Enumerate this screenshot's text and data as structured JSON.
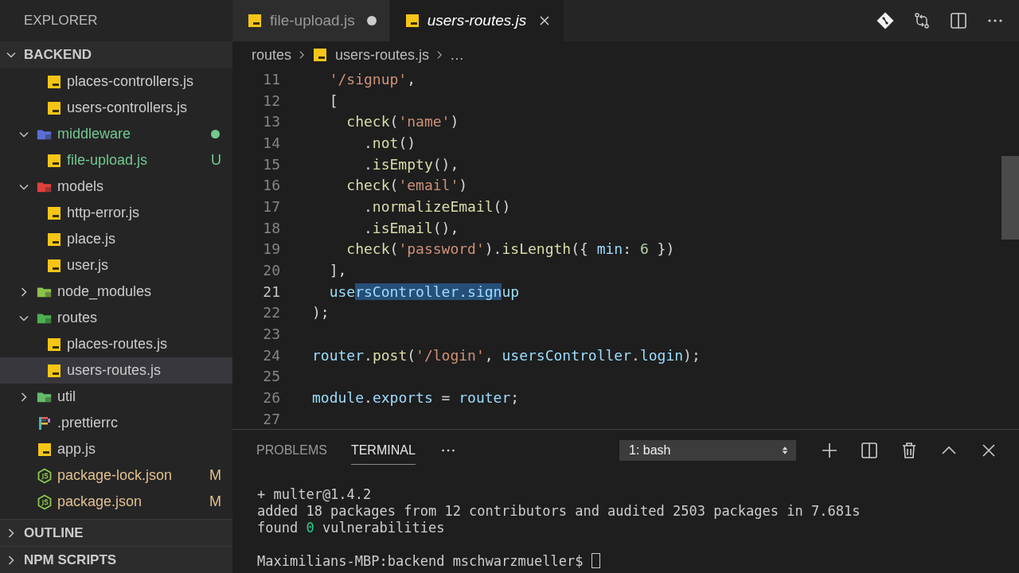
{
  "sidebar": {
    "title": "EXPLORER",
    "section": {
      "label": "BACKEND",
      "expanded": true,
      "tree": [
        {
          "kind": "group",
          "children": [
            {
              "kind": "js",
              "label": "places-controllers.js",
              "selected": false,
              "untracked": false,
              "modified": false
            },
            {
              "kind": "js",
              "label": "users-controllers.js",
              "selected": false,
              "untracked": false,
              "modified": false
            }
          ]
        },
        {
          "kind": "folder",
          "label": "middleware",
          "color": "#5a6fd6",
          "expanded": true,
          "selected": false,
          "untracked": true,
          "modified": false,
          "children": [
            {
              "kind": "js",
              "label": "file-upload.js",
              "selected": false,
              "untracked": true,
              "modified": false,
              "badge": "U"
            }
          ]
        },
        {
          "kind": "folder",
          "label": "models",
          "color": "#e0413c",
          "expanded": true,
          "selected": false,
          "untracked": false,
          "modified": false,
          "children": [
            {
              "kind": "js",
              "label": "http-error.js",
              "selected": false,
              "untracked": false,
              "modified": false
            },
            {
              "kind": "js",
              "label": "place.js",
              "selected": false,
              "untracked": false,
              "modified": false
            },
            {
              "kind": "js",
              "label": "user.js",
              "selected": false,
              "untracked": false,
              "modified": false
            }
          ]
        },
        {
          "kind": "folder",
          "label": "node_modules",
          "color": "#8bc34a",
          "expanded": false,
          "selected": false,
          "untracked": false,
          "modified": false
        },
        {
          "kind": "folder",
          "label": "routes",
          "color": "#4caf50",
          "expanded": true,
          "selected": false,
          "untracked": false,
          "modified": false,
          "children": [
            {
              "kind": "js",
              "label": "places-routes.js",
              "selected": false,
              "untracked": false,
              "modified": false
            },
            {
              "kind": "js",
              "label": "users-routes.js",
              "selected": true,
              "untracked": false,
              "modified": false
            }
          ]
        },
        {
          "kind": "folder",
          "label": "util",
          "color": "#66bb6a",
          "expanded": false,
          "selected": false,
          "untracked": false,
          "modified": false
        },
        {
          "kind": "prettier",
          "label": ".prettierrc",
          "selected": false,
          "untracked": false,
          "modified": false
        },
        {
          "kind": "js",
          "label": "app.js",
          "selected": false,
          "untracked": false,
          "modified": false
        },
        {
          "kind": "json",
          "label": "package-lock.json",
          "selected": false,
          "untracked": false,
          "modified": true,
          "badge": "M"
        },
        {
          "kind": "json",
          "label": "package.json",
          "selected": false,
          "untracked": false,
          "modified": true,
          "badge": "M"
        }
      ]
    },
    "collapsed_sections": [
      {
        "label": "OUTLINE",
        "expanded": false
      },
      {
        "label": "NPM SCRIPTS",
        "expanded": false
      }
    ]
  },
  "tabs": [
    {
      "label": "file-upload.js",
      "selected": false,
      "modified": true,
      "preview": false
    },
    {
      "label": "users-routes.js",
      "selected": true,
      "modified": false,
      "preview": true
    }
  ],
  "breadcrumb": [
    {
      "label": "routes",
      "kind": "folder"
    },
    {
      "label": "users-routes.js",
      "kind": "js"
    },
    {
      "label": "…",
      "kind": "more"
    }
  ],
  "editor": {
    "lines": [
      {
        "number": "11",
        "tokens": [
          {
            "kind": "str",
            "text": "  '/signup'"
          },
          {
            "kind": "punct",
            "text": ","
          }
        ]
      },
      {
        "number": "12",
        "tokens": [
          {
            "kind": "punct",
            "text": "  ["
          }
        ]
      },
      {
        "number": "13",
        "tokens": [
          {
            "kind": "fn",
            "text": "    check"
          },
          {
            "kind": "punct",
            "text": "("
          },
          {
            "kind": "str",
            "text": "'name'"
          },
          {
            "kind": "punct",
            "text": ")"
          }
        ]
      },
      {
        "number": "14",
        "tokens": [
          {
            "kind": "punct",
            "text": "      ."
          },
          {
            "kind": "fn",
            "text": "not"
          },
          {
            "kind": "punct",
            "text": "()"
          }
        ]
      },
      {
        "number": "15",
        "tokens": [
          {
            "kind": "punct",
            "text": "      ."
          },
          {
            "kind": "fn",
            "text": "isEmpty"
          },
          {
            "kind": "punct",
            "text": "(),"
          }
        ]
      },
      {
        "number": "16",
        "tokens": [
          {
            "kind": "fn",
            "text": "    check"
          },
          {
            "kind": "punct",
            "text": "("
          },
          {
            "kind": "str",
            "text": "'email'"
          },
          {
            "kind": "punct",
            "text": ")"
          }
        ]
      },
      {
        "number": "17",
        "tokens": [
          {
            "kind": "punct",
            "text": "      ."
          },
          {
            "kind": "fn",
            "text": "normalizeEmail"
          },
          {
            "kind": "punct",
            "text": "()"
          }
        ]
      },
      {
        "number": "18",
        "tokens": [
          {
            "kind": "punct",
            "text": "      ."
          },
          {
            "kind": "fn",
            "text": "isEmail"
          },
          {
            "kind": "punct",
            "text": "(),"
          }
        ]
      },
      {
        "number": "19",
        "tokens": [
          {
            "kind": "fn",
            "text": "    check"
          },
          {
            "kind": "punct",
            "text": "("
          },
          {
            "kind": "str",
            "text": "'password'"
          },
          {
            "kind": "punct",
            "text": ")."
          },
          {
            "kind": "fn",
            "text": "isLength"
          },
          {
            "kind": "punct",
            "text": "({ "
          },
          {
            "kind": "var",
            "text": "min"
          },
          {
            "kind": "punct",
            "text": ": "
          },
          {
            "kind": "num",
            "text": "6"
          },
          {
            "kind": "punct",
            "text": " })"
          }
        ]
      },
      {
        "number": "20",
        "tokens": [
          {
            "kind": "punct",
            "text": "  ],"
          }
        ]
      },
      {
        "number": "21",
        "current": true,
        "tokens": [
          {
            "kind": "var",
            "text": "  use"
          },
          {
            "kind": "sel",
            "text": "rsController.sign"
          },
          {
            "kind": "var",
            "text": "up"
          }
        ]
      },
      {
        "number": "22",
        "tokens": [
          {
            "kind": "punct",
            "text": ");"
          }
        ]
      },
      {
        "number": "23"
      },
      {
        "number": "24",
        "tokens": [
          {
            "kind": "var",
            "text": "router"
          },
          {
            "kind": "punct",
            "text": "."
          },
          {
            "kind": "fn",
            "text": "post"
          },
          {
            "kind": "punct",
            "text": "("
          },
          {
            "kind": "str",
            "text": "'/login'"
          },
          {
            "kind": "punct",
            "text": ", "
          },
          {
            "kind": "var",
            "text": "usersController"
          },
          {
            "kind": "punct",
            "text": "."
          },
          {
            "kind": "var",
            "text": "login"
          },
          {
            "kind": "punct",
            "text": ");"
          }
        ]
      },
      {
        "number": "25"
      },
      {
        "number": "26",
        "tokens": [
          {
            "kind": "var",
            "text": "module"
          },
          {
            "kind": "punct",
            "text": "."
          },
          {
            "kind": "var",
            "text": "exports"
          },
          {
            "kind": "punct",
            "text": " = "
          },
          {
            "kind": "var",
            "text": "router"
          },
          {
            "kind": "punct",
            "text": ";"
          }
        ]
      },
      {
        "number": "27"
      }
    ]
  },
  "panel": {
    "tabs": [
      {
        "label": "PROBLEMS",
        "selected": false
      },
      {
        "label": "TERMINAL",
        "selected": true
      }
    ],
    "terminal_select": "1: bash",
    "terminal": [
      {
        "segments": [
          {
            "kind": "plain",
            "text": "+ multer@1.4.2"
          }
        ]
      },
      {
        "segments": [
          {
            "kind": "plain",
            "text": "added 18 packages from 12 contributors and audited 2503 packages in 7.681s"
          }
        ]
      },
      {
        "segments": [
          {
            "kind": "plain",
            "text": "found "
          },
          {
            "kind": "ok",
            "text": "0"
          },
          {
            "kind": "plain",
            "text": " vulnerabilities"
          }
        ]
      },
      {
        "segments": [
          {
            "kind": "plain",
            "text": "Maximilians-MBP:backend mschwarzmueller$ "
          }
        ],
        "cursor": true,
        "spaced": true
      }
    ]
  }
}
